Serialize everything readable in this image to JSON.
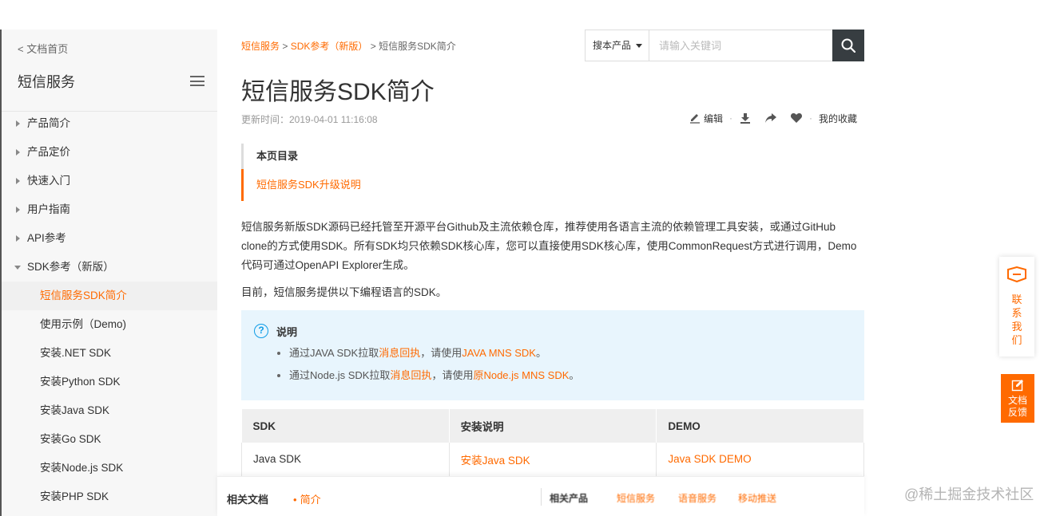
{
  "sidebar": {
    "back_label": "< 文档首页",
    "title": "短信服务",
    "items": [
      {
        "label": "产品简介"
      },
      {
        "label": "产品定价"
      },
      {
        "label": "快速入门"
      },
      {
        "label": "用户指南"
      },
      {
        "label": "API参考"
      },
      {
        "label": "SDK参考（新版）"
      }
    ],
    "sub_items": [
      {
        "label": "短信服务SDK简介"
      },
      {
        "label": "使用示例（Demo)"
      },
      {
        "label": "安装.NET SDK"
      },
      {
        "label": "安装Python SDK"
      },
      {
        "label": "安装Java SDK"
      },
      {
        "label": "安装Go SDK"
      },
      {
        "label": "安装Node.js SDK"
      },
      {
        "label": "安装PHP SDK"
      }
    ]
  },
  "breadcrumb": {
    "items": [
      "短信服务",
      "SDK参考（新版）",
      "短信服务SDK简介"
    ],
    "sep": ">"
  },
  "search": {
    "scope": "搜本产品",
    "placeholder": "请输入关键词"
  },
  "page": {
    "title": "短信服务SDK简介",
    "update_time": "更新时间：2019-04-01 11:16:08"
  },
  "toolbar": {
    "edit": "编辑",
    "favorites": "我的收藏"
  },
  "toc": {
    "heading": "本页目录",
    "items": [
      "短信服务SDK升级说明"
    ]
  },
  "content": {
    "para1": "短信服务新版SDK源码已经托管至开源平台Github及主流依赖仓库，推荐使用各语言主流的依赖管理工具安装，或通过GitHub clone的方式使用SDK。所有SDK均只依赖SDK核心库，您可以直接使用SDK核心库，使用CommonRequest方式进行调用，Demo代码可通过OpenAPI Explorer生成。",
    "para2": "目前，短信服务提供以下编程语言的SDK。"
  },
  "note": {
    "title": "说明",
    "items": [
      {
        "pre": "通过JAVA SDK拉取",
        "link1": "消息回执",
        "mid": "，请使用",
        "link2": "JAVA MNS SDK",
        "post": "。"
      },
      {
        "pre": "通过Node.js SDK拉取",
        "link1": "消息回执",
        "mid": "，请使用",
        "link2": "原Node.js MNS SDK",
        "post": "。"
      }
    ]
  },
  "table": {
    "headers": [
      "SDK",
      "安装说明",
      "DEMO"
    ],
    "rows": [
      {
        "sdk": "Java SDK",
        "install": "安装Java SDK",
        "demo": "Java SDK DEMO"
      }
    ]
  },
  "bottom_bar": {
    "label": "相关文档",
    "link": "简介",
    "right_label": "相关产品",
    "right_links": [
      "短信服务",
      "语音服务",
      "移动推送"
    ]
  },
  "float": {
    "contact": "联系我们",
    "feedback_line1": "文档",
    "feedback_line2": "反馈"
  },
  "watermark": "@稀土掘金技术社区",
  "colors": {
    "accent": "#ff6a00",
    "note_bg": "#e8f5fd",
    "search_btn": "#373d41"
  }
}
